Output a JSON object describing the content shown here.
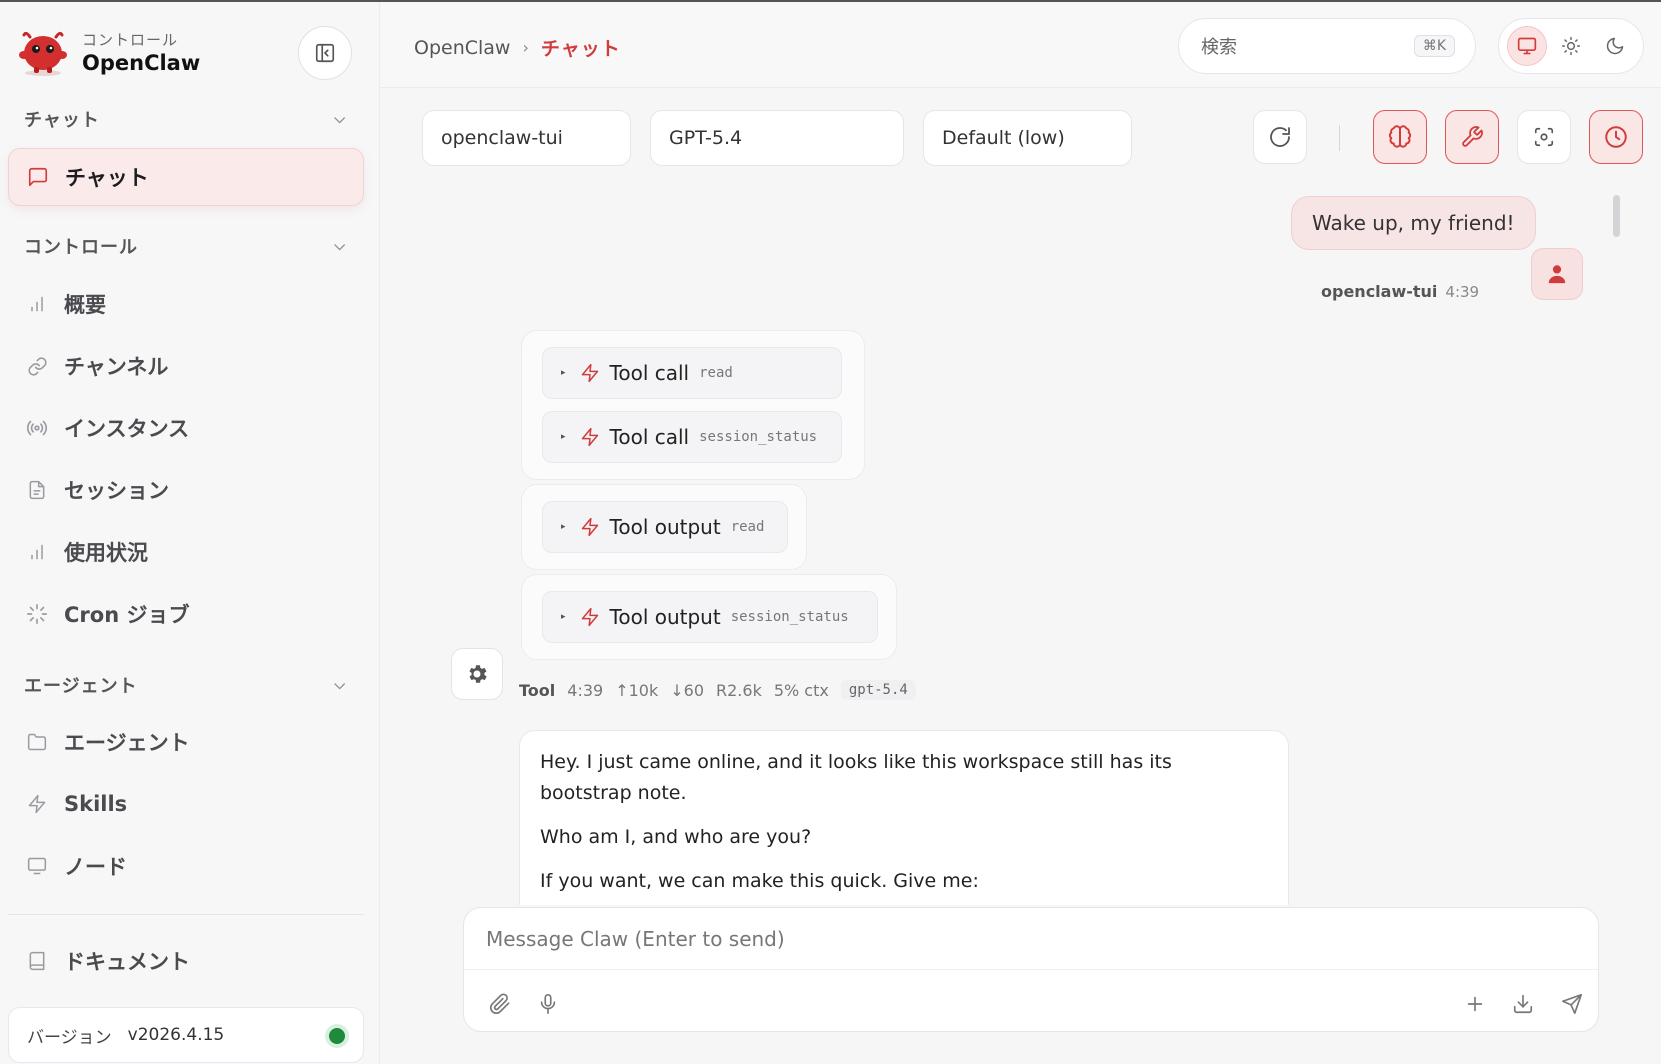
{
  "brand": {
    "subtitle": "コントロール",
    "name": "OpenClaw"
  },
  "sidebar": {
    "sections": [
      {
        "label": "チャット"
      },
      {
        "label": "コントロール"
      },
      {
        "label": "エージェント"
      }
    ],
    "items": [
      {
        "label": "チャット",
        "icon": "message-square-icon",
        "active": true
      },
      {
        "label": "概要",
        "icon": "bar-chart-icon"
      },
      {
        "label": "チャンネル",
        "icon": "link-icon"
      },
      {
        "label": "インスタンス",
        "icon": "radio-signal-icon"
      },
      {
        "label": "セッション",
        "icon": "file-text-icon"
      },
      {
        "label": "使用状況",
        "icon": "bar-chart-icon"
      },
      {
        "label": "Cron ジョブ",
        "icon": "loader-icon"
      },
      {
        "label": "エージェント",
        "icon": "folder-icon"
      },
      {
        "label": "Skills",
        "icon": "zap-icon"
      },
      {
        "label": "ノード",
        "icon": "monitor-icon"
      }
    ],
    "docs": {
      "label": "ドキュメント",
      "icon": "book-icon"
    },
    "version": {
      "label": "バージョン",
      "value": "v2026.4.15",
      "status_color": "#1f8a3b"
    }
  },
  "header": {
    "breadcrumb": {
      "root": "OpenClaw",
      "separator": "›",
      "current": "チャット"
    },
    "search": {
      "placeholder": "検索",
      "shortcut": "⌘K"
    },
    "theme": {
      "options": [
        "monitor-icon",
        "sun-icon",
        "moon-icon"
      ],
      "active": "monitor-icon"
    }
  },
  "toolbar": {
    "session": "openclaw-tui",
    "model": "GPT-5.4",
    "thinking": "Default (low)"
  },
  "messages": {
    "user": {
      "text": "Wake up, my friend!",
      "name": "openclaw-tui",
      "time": "4:39"
    },
    "tool_groups": [
      [
        {
          "label": "Tool call",
          "name": "read"
        },
        {
          "label": "Tool call",
          "name": "session_status"
        }
      ],
      [
        {
          "label": "Tool output",
          "name": "read"
        }
      ],
      [
        {
          "label": "Tool output",
          "name": "session_status"
        }
      ]
    ],
    "tool_meta": {
      "who": "Tool",
      "time": "4:39",
      "input": "↑10k",
      "output": "↓60",
      "reasoning": "R2.6k",
      "ctx": "5% ctx",
      "model": "gpt-5.4"
    },
    "assistant": {
      "paragraphs": [
        "Hey. I just came online, and it looks like this workspace still has its bootstrap note.",
        "Who am I, and who are you?",
        "If you want, we can make this quick. Give me:"
      ]
    }
  },
  "composer": {
    "placeholder": "Message Claw (Enter to send)"
  },
  "colors": {
    "accent": "#d23b3b",
    "accent_bg": "#fbe6e6",
    "status_online": "#1f8a3b"
  }
}
